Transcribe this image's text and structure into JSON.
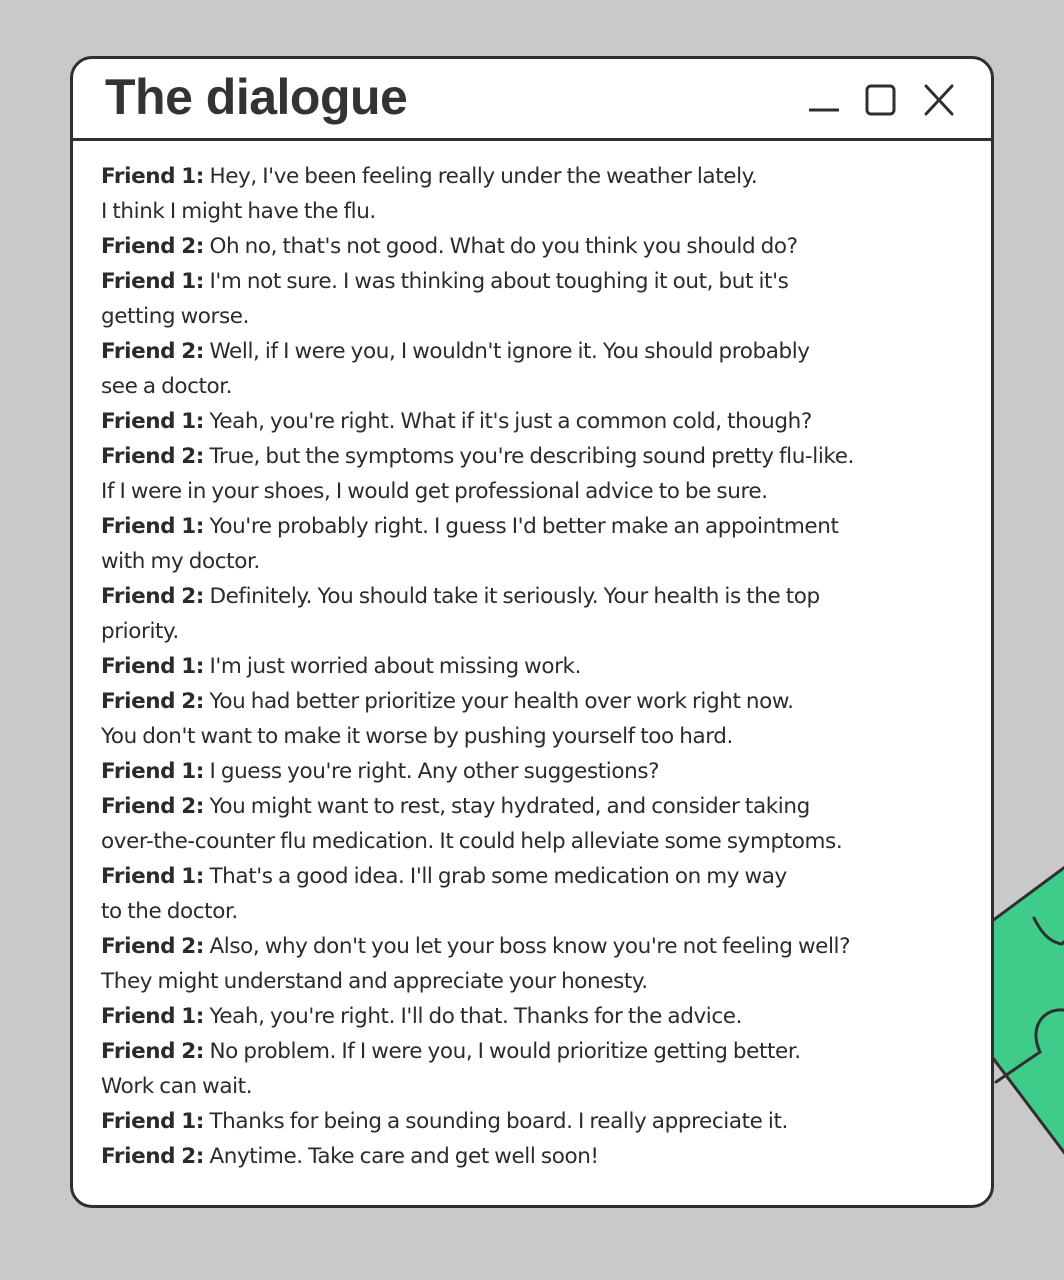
{
  "window": {
    "title": "The dialogue",
    "controls": [
      {
        "name": "minimize",
        "icon": "minimize-icon"
      },
      {
        "name": "maximize",
        "icon": "maximize-icon"
      },
      {
        "name": "close",
        "icon": "close-icon"
      }
    ]
  },
  "colors": {
    "background": "#c9c9c9",
    "window_border": "#2f2f2f",
    "puzzle_fill": "#3fcc8a"
  },
  "dialogue": [
    {
      "speaker": "Friend 1:",
      "lines": [
        "Hey, I've been feeling really under the weather lately.",
        "I think I might have the flu."
      ]
    },
    {
      "speaker": "Friend 2:",
      "lines": [
        "Oh no, that's not good. What do you think you should do?"
      ]
    },
    {
      "speaker": "Friend 1:",
      "lines": [
        "I'm not sure. I was thinking about toughing it out, but it's",
        "getting worse."
      ]
    },
    {
      "speaker": "Friend 2:",
      "lines": [
        "Well, if I were you, I wouldn't ignore it. You should probably",
        "see  a doctor."
      ]
    },
    {
      "speaker": "Friend 1:",
      "lines": [
        "Yeah, you're right. What if it's just a common cold, though?"
      ]
    },
    {
      "speaker": "Friend 2:",
      "lines": [
        "True, but the symptoms you're describing sound pretty flu-like.",
        "If I were in your shoes, I would get professional advice to be sure."
      ]
    },
    {
      "speaker": "Friend 1:",
      "lines": [
        "You're probably right. I guess I'd better make an appointment",
        "with my doctor."
      ]
    },
    {
      "speaker": "Friend 2:",
      "lines": [
        "Definitely. You should take it seriously. Your health is the top",
        "priority."
      ]
    },
    {
      "speaker": "Friend 1:",
      "lines": [
        "I'm just worried about missing work."
      ]
    },
    {
      "speaker": "Friend 2:",
      "lines": [
        "You had better prioritize your health over work right now.",
        "You don't want to make it worse by pushing yourself too hard."
      ]
    },
    {
      "speaker": "Friend 1:",
      "lines": [
        "I guess you're right. Any other suggestions?"
      ]
    },
    {
      "speaker": "Friend 2:",
      "lines": [
        "You might want to rest, stay hydrated, and consider taking",
        "over-the-counter flu medication. It could help alleviate some symptoms."
      ]
    },
    {
      "speaker": "Friend 1:",
      "lines": [
        "That's a good idea. I'll grab some medication on my way",
        "to the doctor."
      ]
    },
    {
      "speaker": "Friend 2:",
      "lines": [
        "Also, why don't you let your boss know you're not feeling well?",
        "They might understand and appreciate your honesty."
      ]
    },
    {
      "speaker": "Friend 1:",
      "lines": [
        "Yeah, you're right. I'll do that. Thanks for the advice."
      ]
    },
    {
      "speaker": "Friend 2:",
      "lines": [
        "No problem. If I were you, I would prioritize getting better.",
        "Work can wait."
      ]
    },
    {
      "speaker": "Friend 1:",
      "lines": [
        "Thanks for being a sounding board. I really appreciate it."
      ]
    },
    {
      "speaker": "Friend 2:",
      "lines": [
        "Anytime. Take care and get well soon!"
      ]
    }
  ]
}
